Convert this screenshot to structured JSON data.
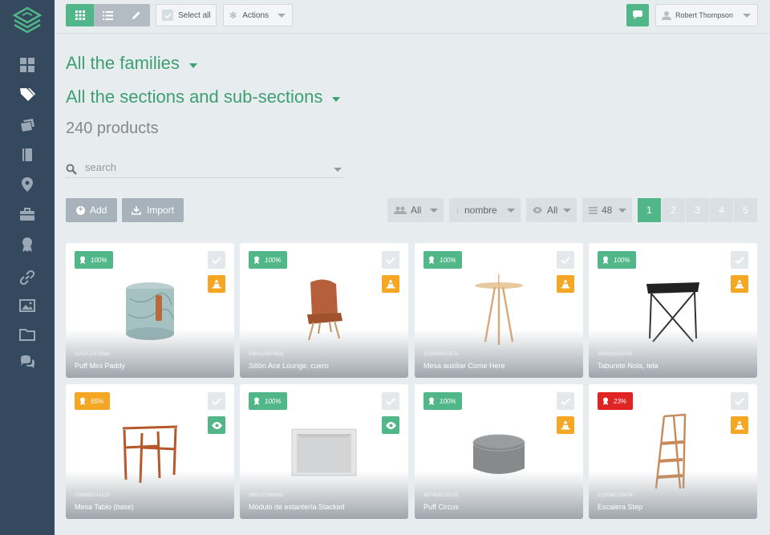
{
  "topbar": {
    "select_all_label": "Select all",
    "actions_label": "Actions",
    "user_name": "Robert Thompson"
  },
  "header": {
    "families_title": "All the families",
    "sections_title": "All the sections and sub-sections",
    "product_count": "240 products"
  },
  "search": {
    "placeholder": "search"
  },
  "toolbar": {
    "add_label": "Add",
    "import_label": "Import",
    "filter_users": "All",
    "sort_by": "nombre",
    "filter_visibility": "All",
    "per_page": "48"
  },
  "pagination": {
    "pages": [
      "1",
      "2",
      "3",
      "4",
      "5"
    ],
    "current": "1"
  },
  "colors": {
    "accent": "#52b788",
    "title": "#3e9f73",
    "sidebar": "#34495e",
    "warning": "#f5a623",
    "danger": "#e02424"
  },
  "products": [
    {
      "completeness": "100%",
      "completeness_value": 100,
      "code": "5201471470369",
      "name": "Puff Mini Paddy",
      "status_icon": "traffic-cone-icon"
    },
    {
      "completeness": "100%",
      "completeness_value": 100,
      "code": "6584123974568",
      "name": "Sillón Ace Lounge, cuero",
      "status_icon": "traffic-cone-icon"
    },
    {
      "completeness": "100%",
      "completeness_value": 100,
      "code": "2139806522670",
      "name": "Mesa auxiliar Come Here",
      "status_icon": "traffic-cone-icon"
    },
    {
      "completeness": "100%",
      "completeness_value": 100,
      "code": "3069832541045",
      "name": "Taburete Nola, tela",
      "status_icon": "traffic-cone-icon"
    },
    {
      "completeness": "65%",
      "completeness_value": 65,
      "code": "1369852014123",
      "name": "Mesa Tablo (base)",
      "status_icon": "eye-icon"
    },
    {
      "completeness": "100%",
      "completeness_value": 100,
      "code": "3650127889631",
      "name": "Módulo de estantería Stacked",
      "status_icon": "eye-icon"
    },
    {
      "completeness": "100%",
      "completeness_value": 100,
      "code": "9874635210215",
      "name": "Puff Circus",
      "status_icon": "traffic-cone-icon"
    },
    {
      "completeness": "23%",
      "completeness_value": 23,
      "code": "3128960125474",
      "name": "Escalera Step",
      "status_icon": "traffic-cone-icon"
    }
  ]
}
